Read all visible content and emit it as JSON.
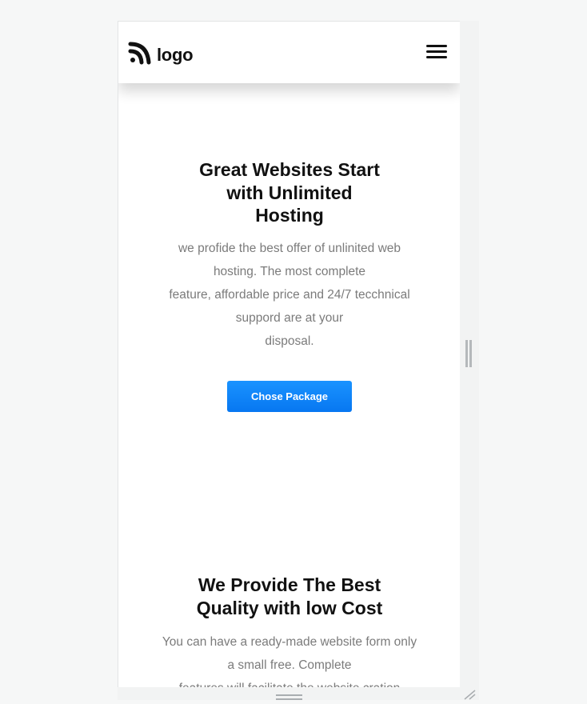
{
  "header": {
    "logo_text": "logo",
    "logo_icon": "signal-wave-logo-icon",
    "menu_icon": "hamburger-menu-icon"
  },
  "hero": {
    "title_lines": [
      "Great Websites Start",
      "with Unlimited",
      "Hosting"
    ],
    "text_lines": [
      "we profide the best offer of unlinited web",
      "hosting. The most complete",
      "feature, affordable price and 24/7 tecchnical",
      "suppord are at your",
      "disposal."
    ],
    "cta_label": "Chose Package"
  },
  "features": {
    "title_lines": [
      "We Provide The Best",
      "Quality with low Cost"
    ],
    "text_lines": [
      "You can have a ready-made website form only",
      "a small free. Complete",
      "features will facilitate the website cration"
    ]
  },
  "colors": {
    "accent": "#0a84ff",
    "body_text": "#7b7b7b",
    "heading": "#111111"
  }
}
